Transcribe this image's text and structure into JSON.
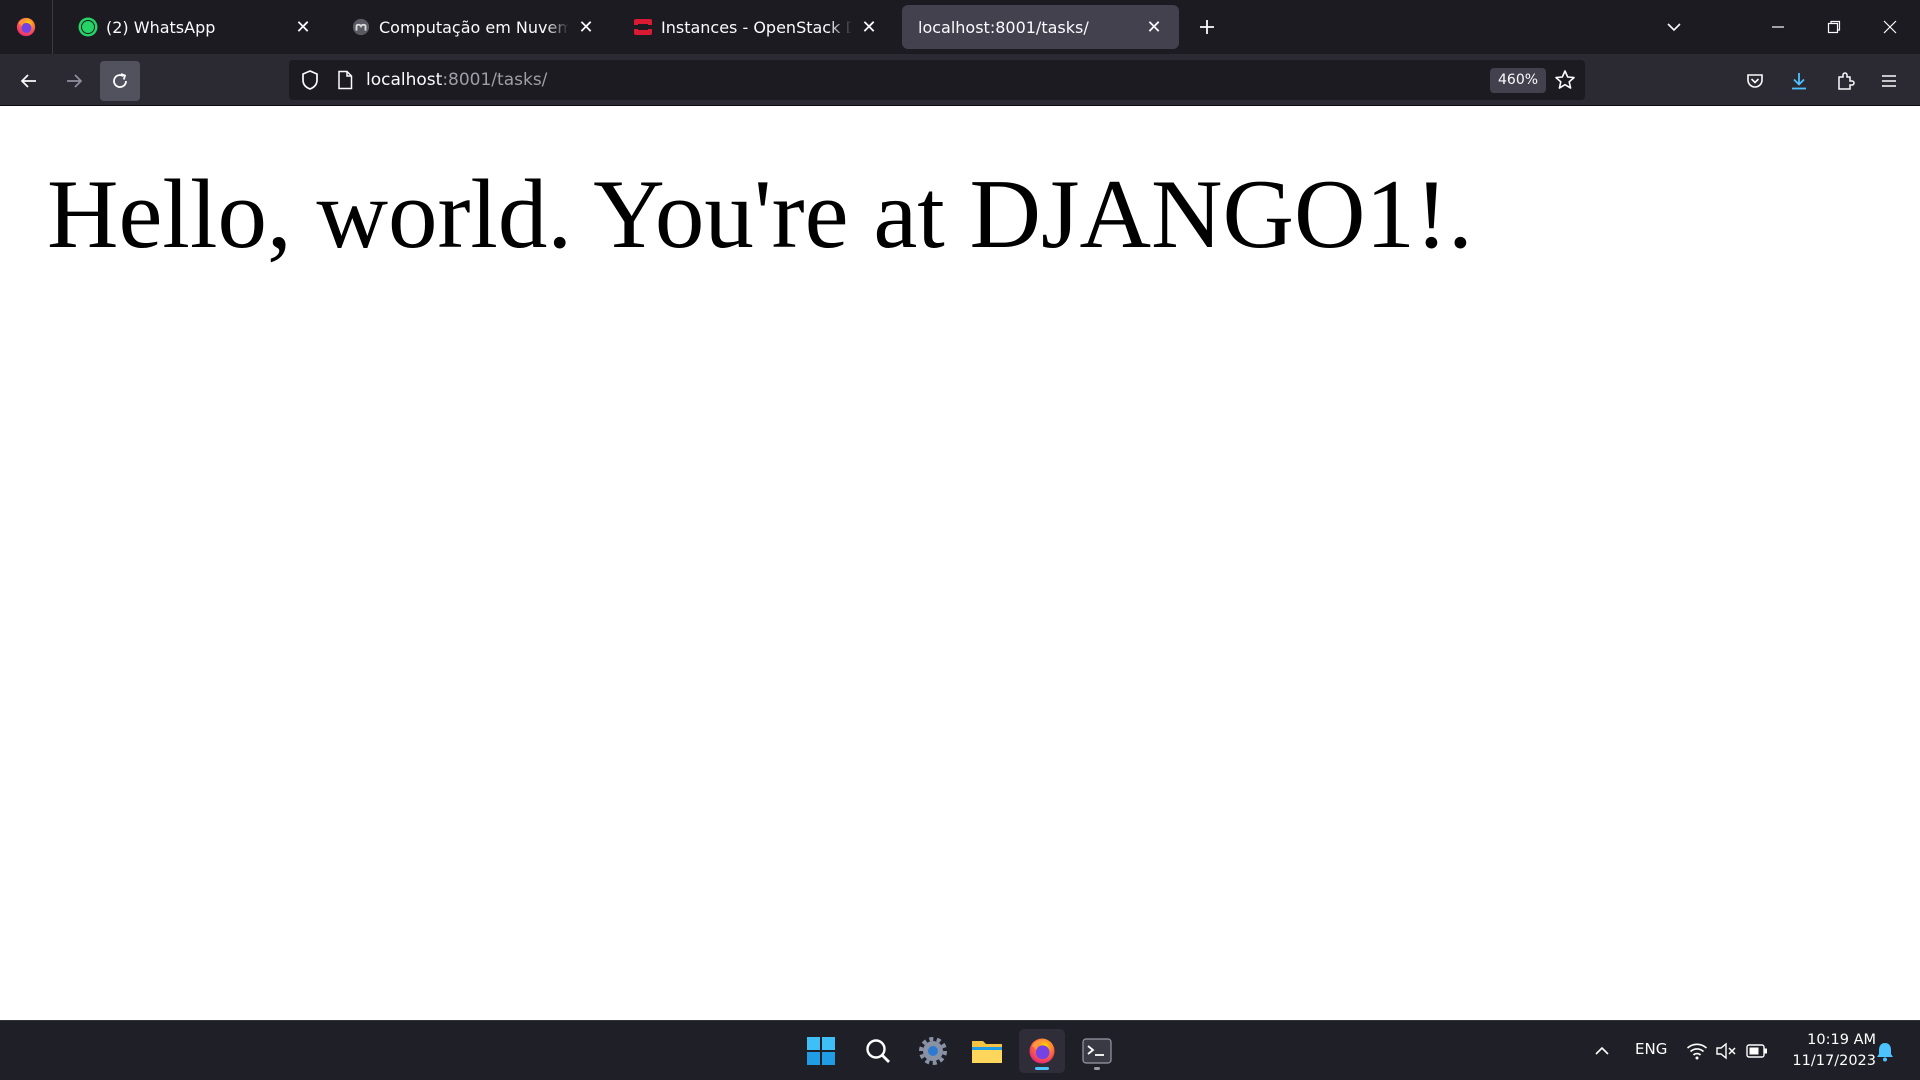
{
  "browser": {
    "tabs": [
      {
        "title": "(2) WhatsApp",
        "badge": "2",
        "favicon": "whatsapp-icon",
        "active": false
      },
      {
        "title": "Computação em Nuvem - Computação em Nuvem",
        "favicon": "moodle-icon",
        "active": false
      },
      {
        "title": "Instances - OpenStack Dashboard",
        "favicon": "openstack-icon",
        "active": false
      },
      {
        "title": "localhost:8001/tasks/",
        "favicon": "",
        "active": true
      }
    ],
    "url": {
      "host": "localhost",
      "rest": ":8001/tasks/"
    },
    "zoom": "460%"
  },
  "page": {
    "heading": "Hello, world. You're at DJANGO1!."
  },
  "taskbar": {
    "language": "ENG",
    "time": "10:19 AM",
    "date": "11/17/2023"
  },
  "colors": {
    "chrome_dark": "#1c1b22",
    "toolbar": "#2b2a33",
    "active_tab": "#42414d",
    "download_accent": "#4cc2ff",
    "whatsapp_green": "#25d366",
    "openstack_red": "#da1a32"
  }
}
